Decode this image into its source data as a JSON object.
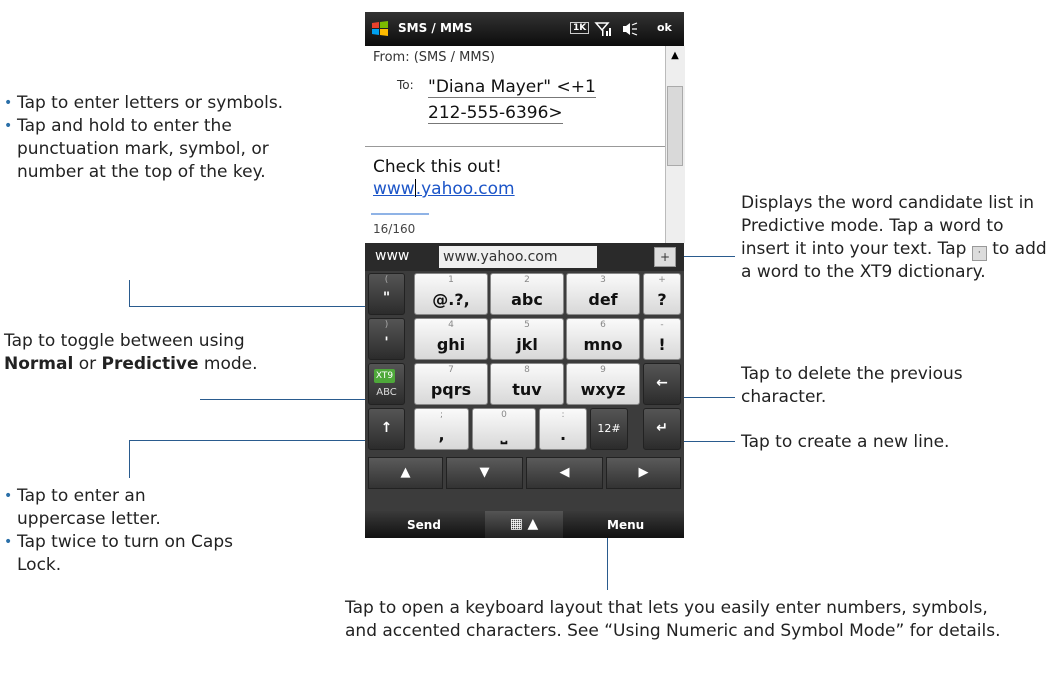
{
  "phone": {
    "title": "SMS / MMS",
    "status_icons": [
      "1K",
      "signal-icon",
      "speaker-icon"
    ],
    "ok_label": "ok",
    "from_label": "From:",
    "from_value": "(SMS / MMS)",
    "to_label": "To:",
    "to_line1": "\"Diana Mayer\" <+1",
    "to_line2": "212-555-6396>",
    "body_line1": "Check this out!",
    "body_link_pre": "www",
    "body_link_post": ".yahoo.com",
    "counter": "16/160",
    "candidate_1": "www",
    "candidate_2": "www.yahoo.com",
    "add_button": "+",
    "keys": {
      "k_paren": {
        "top": "(",
        "main": "\""
      },
      "k_1": {
        "top": "1",
        "main": "@.?,"
      },
      "k_2": {
        "top": "2",
        "main": "abc"
      },
      "k_3": {
        "top": "3",
        "main": "def"
      },
      "k_q": {
        "top": "+",
        "main": "?"
      },
      "k_rparen": {
        "top": ")",
        "main": "'"
      },
      "k_4": {
        "top": "4",
        "main": "ghi"
      },
      "k_5": {
        "top": "5",
        "main": "jkl"
      },
      "k_6": {
        "top": "6",
        "main": "mno"
      },
      "k_excl": {
        "top": "-",
        "main": "!"
      },
      "k_xt9": {
        "top": "XT9",
        "main": "ABC"
      },
      "k_7": {
        "top": "7",
        "main": "pqrs"
      },
      "k_8": {
        "top": "8",
        "main": "tuv"
      },
      "k_9": {
        "top": "9",
        "main": "wxyz"
      },
      "k_back": {
        "main": "←"
      },
      "k_shift": {
        "main": "↑"
      },
      "k_comma": {
        "top": ";",
        "main": ","
      },
      "k_0": {
        "top": "0",
        "main": "⎵"
      },
      "k_period": {
        "top": ":",
        "main": "."
      },
      "k_12": {
        "main": "12#"
      },
      "k_enter": {
        "main": "↵"
      }
    },
    "arrows": [
      "▲",
      "▼",
      "◀",
      "▶"
    ],
    "softkey_left": "Send",
    "softkey_mid": "▦ ▲",
    "softkey_right": "Menu"
  },
  "annotations": {
    "letters_1": "Tap to enter letters or symbols.",
    "letters_2": "Tap and hold to enter the punctuation mark, symbol, or number at the top of the key.",
    "mode_pre": "Tap to toggle between using ",
    "mode_normal": "Normal",
    "mode_or": " or ",
    "mode_predictive": "Predictive",
    "mode_post": " mode.",
    "upper_1": "Tap to enter an uppercase letter.",
    "upper_2": "Tap twice to turn on Caps Lock.",
    "cand_a": "Displays the word candidate list in Predictive mode. Tap a word to insert it into your text. Tap ",
    "cand_b": " to add a word to the XT9 dictionary.",
    "delete": "Tap to delete the previous character.",
    "newline": "Tap to create a new line.",
    "numeric": "Tap to open a keyboard layout that lets you easily enter numbers, symbols, and accented characters. See “Using Numeric and Symbol Mode” for details."
  }
}
